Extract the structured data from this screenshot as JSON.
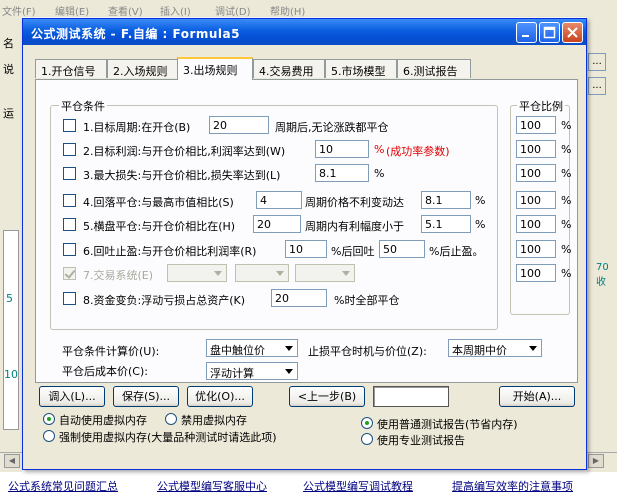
{
  "background": {
    "menu": [
      "文件(F)",
      "编辑(E)",
      "查看(V)",
      "插入(I)",
      "调试(D)",
      "帮助(H)"
    ],
    "left_labels": [
      "名",
      "说",
      "运"
    ],
    "left_numbers": [
      "5",
      "10"
    ],
    "right_text": "70收",
    "right_btn": "...",
    "links": [
      "公式系统常见问题汇总",
      "公式模型编写客服中心",
      "公式模型编写调试教程",
      "提高编写效率的注意事项"
    ]
  },
  "dialog": {
    "title": "公式测试系统 - F.自编 : Formula5",
    "tabs": [
      "1.开仓信号",
      "2.入场规则",
      "3.出场规则",
      "4.交易费用",
      "5.市场模型",
      "6.测试报告"
    ],
    "active_tab": 2,
    "close_conditions_title": "平仓条件",
    "ratio_title": "平仓比例",
    "percent": "%",
    "rules": [
      {
        "checked": false,
        "label": "1.目标周期:在开仓(B)",
        "value": "20",
        "suffix": "周期后,无论涨跌都平仓",
        "ratio": "100"
      },
      {
        "checked": false,
        "label": "2.目标利润:与开仓价相比,利润率达到(W)",
        "value": "10",
        "suffix": "%",
        "note": "(成功率参数)",
        "ratio": "100"
      },
      {
        "checked": false,
        "label": "3.最大损失:与开仓价相比,损失率达到(L)",
        "value": "8.1",
        "suffix": "%",
        "ratio": "100"
      },
      {
        "checked": false,
        "label": "4.回落平仓:与最高市值相比(S)",
        "value": "4",
        "mid": "周期价格不利变动达",
        "value2": "8.1",
        "suffix": "%",
        "ratio": "100"
      },
      {
        "checked": false,
        "label": "5.横盘平仓:与开仓价相比在(H)",
        "value": "20",
        "mid": "周期内有利幅度小于",
        "value2": "5.1",
        "suffix": "%",
        "ratio": "100"
      },
      {
        "checked": false,
        "label": "6.回吐止盈:与开仓价相比利润率(R)",
        "value": "10",
        "mid": "%后回吐",
        "value2": "50",
        "suffix": "%后止盈。",
        "ratio": "100"
      },
      {
        "checked": true,
        "disabled": true,
        "label": "7.交易系统(E)",
        "ratio": "100"
      },
      {
        "checked": false,
        "label": "8.资金变负:浮动亏损占总资产(K)",
        "value": "20",
        "suffix": "%时全部平仓"
      }
    ],
    "calc_price_label": "平仓条件计算价(U):",
    "calc_price_value": "盘中触位价",
    "stop_timing_label": "止损平仓时机与价位(Z):",
    "stop_timing_value": "本周期中价",
    "cost_label": "平仓后成本价(C):",
    "cost_value": "浮动计算",
    "buttons": {
      "load": "调入(L)...",
      "save": "保存(S)...",
      "optimize": "优化(O)...",
      "prev": "<上一步(B)",
      "blank": "",
      "start": "开始(A)..."
    },
    "radios_left": [
      "自动使用虚拟内存",
      "禁用虚拟内存",
      "强制使用虚拟内存(大量品种测试时请选此项)"
    ],
    "radios_left_selected": 0,
    "radios_right": [
      "使用普通测试报告(节省内存)",
      "使用专业测试报告"
    ],
    "radios_right_selected": 0
  }
}
